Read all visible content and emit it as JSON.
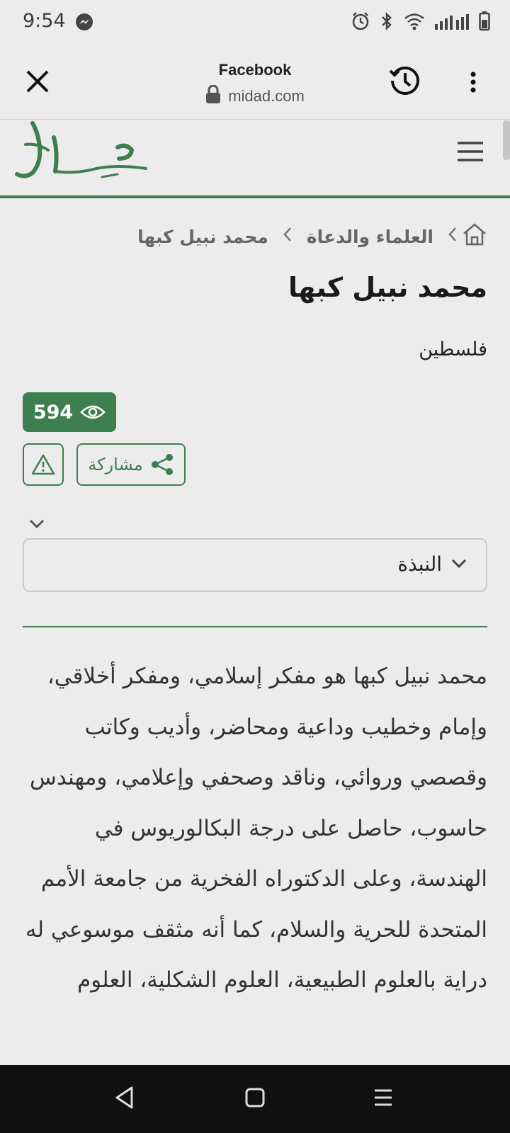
{
  "status_bar": {
    "time": "9:54",
    "left_icons": [
      "messenger-icon"
    ],
    "right_icons": [
      "alarm-icon",
      "bluetooth-icon",
      "wifi-icon",
      "signal-icon",
      "battery-icon"
    ]
  },
  "browser": {
    "title": "Facebook",
    "url": "midad.com",
    "icons": [
      "close-icon",
      "lock-icon",
      "history-icon",
      "more-vert-icon"
    ]
  },
  "site": {
    "logo_icon": "midad-logo",
    "menu_icon": "hamburger-icon",
    "accent_color": "#3d7f4f"
  },
  "breadcrumb": {
    "home_icon": "home-icon",
    "items": [
      "العلماء والدعاة",
      "محمد نبيل كبها"
    ]
  },
  "profile": {
    "name": "محمد نبيل كبها",
    "country": "فلسطين",
    "views": "594",
    "share_label": "مشاركة",
    "icons": [
      "eye-icon",
      "share-icon",
      "warning-icon"
    ]
  },
  "section_select": {
    "selected": "النبذة"
  },
  "bio": "محمد نبيل كبها هو مفكر إسلامي، ومفكر أخلاقي، وإمام وخطيب وداعية ومحاضر، وأديب وكاتب وقصصي وروائي، وناقد وصحفي وإعلامي، ومهندس حاسوب، حاصل على درجة البكالوريوس في الهندسة، وعلى الدكتوراه الفخرية من جامعة الأمم المتحدة للحرية والسلام، كما أنه مثقف موسوعي له دراية بالعلوم الطبيعية، العلوم الشكلية، العلوم",
  "nav_bar": {
    "icons": [
      "back-icon",
      "home-square-icon",
      "recents-icon"
    ]
  }
}
